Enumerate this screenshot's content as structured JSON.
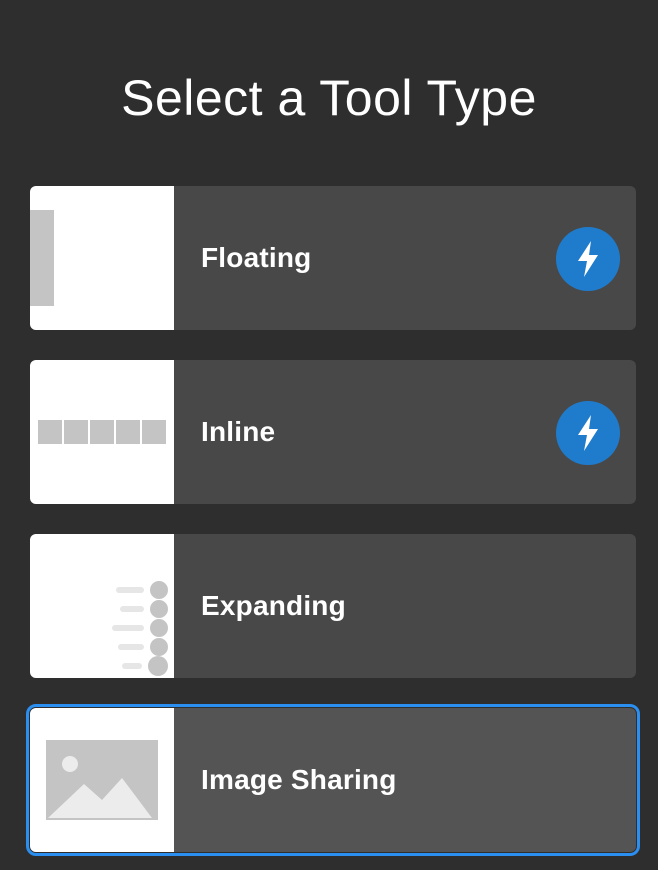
{
  "title": "Select a Tool Type",
  "tools": [
    {
      "label": "Floating",
      "icon": "floating-thumbnail",
      "badge": "lightning-bolt-icon",
      "selected": false
    },
    {
      "label": "Inline",
      "icon": "inline-thumbnail",
      "badge": "lightning-bolt-icon",
      "selected": false
    },
    {
      "label": "Expanding",
      "icon": "expanding-thumbnail",
      "badge": null,
      "selected": false
    },
    {
      "label": "Image Sharing",
      "icon": "image-thumbnail",
      "badge": null,
      "selected": true
    }
  ],
  "colors": {
    "background": "#2e2e2e",
    "card": "#484848",
    "card_selected": "#545454",
    "accent": "#2a8ff0",
    "badge": "#1f7ccc",
    "thumb_gray": "#c4c4c4"
  }
}
